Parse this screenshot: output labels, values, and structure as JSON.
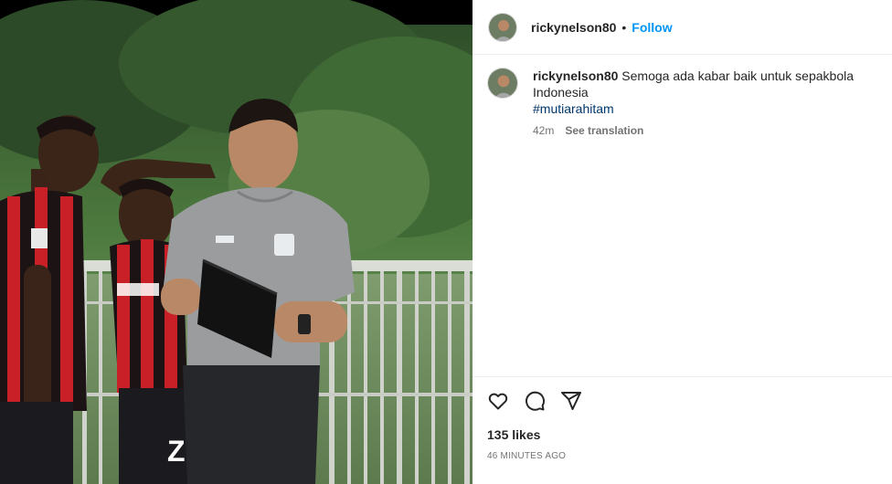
{
  "post": {
    "username": "rickynelson80",
    "separator": "•",
    "follow_label": "Follow"
  },
  "caption": {
    "username": "rickynelson80",
    "text": "Semoga ada kabar baik untuk sepakbola Indonesia",
    "hashtag": "#mutiarahitam",
    "time": "42m",
    "see_translation": "See translation"
  },
  "actions": {
    "icons": [
      "heart-icon",
      "comment-icon",
      "share-icon"
    ]
  },
  "footer": {
    "likes": "135 likes",
    "time_ago": "46 MINUTES AGO"
  },
  "colors": {
    "accent": "#0095f6",
    "hashtag": "#00376b",
    "muted": "#737373",
    "text": "#262626"
  }
}
